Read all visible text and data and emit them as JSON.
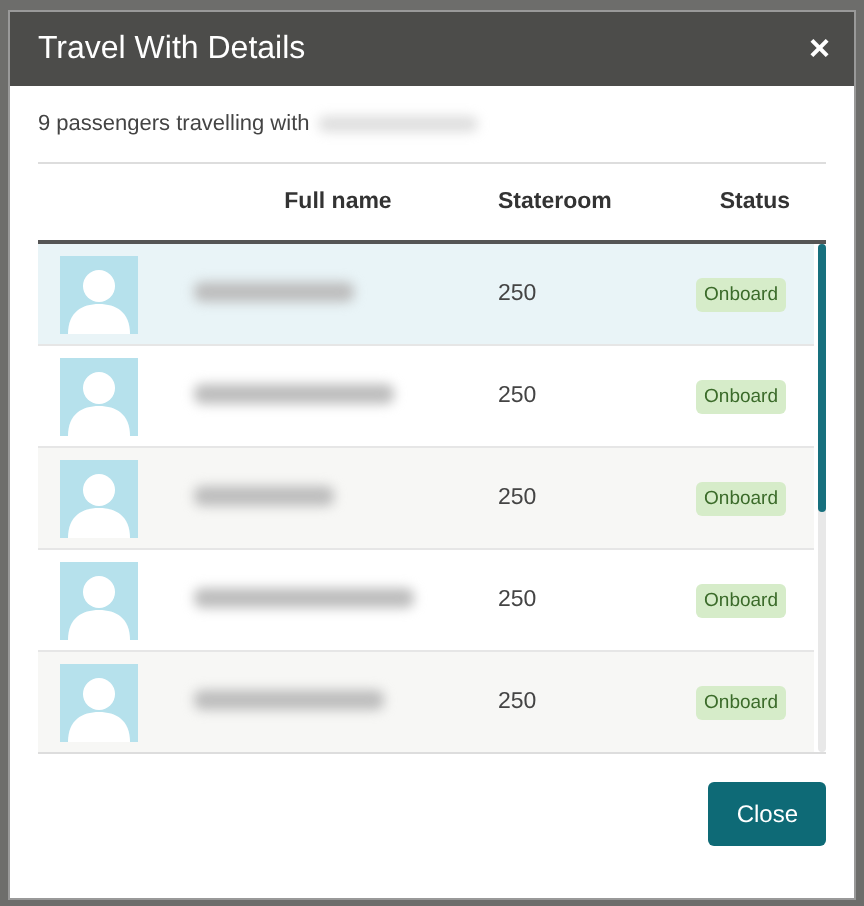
{
  "dialog": {
    "title": "Travel With Details",
    "close_glyph": "×"
  },
  "subtitle": {
    "text": "9 passengers travelling with",
    "name_redacted": true
  },
  "table": {
    "columns": [
      "Full name",
      "Stateroom",
      "Status"
    ],
    "rows": [
      {
        "selected": true,
        "name_redacted": true,
        "stateroom": "250",
        "status": "Onboard"
      },
      {
        "selected": false,
        "name_redacted": true,
        "stateroom": "250",
        "status": "Onboard"
      },
      {
        "selected": false,
        "name_redacted": true,
        "stateroom": "250",
        "status": "Onboard"
      },
      {
        "selected": false,
        "name_redacted": true,
        "stateroom": "250",
        "status": "Onboard"
      },
      {
        "selected": false,
        "name_redacted": true,
        "stateroom": "250",
        "status": "Onboard"
      }
    ]
  },
  "buttons": [
    "Close"
  ]
}
